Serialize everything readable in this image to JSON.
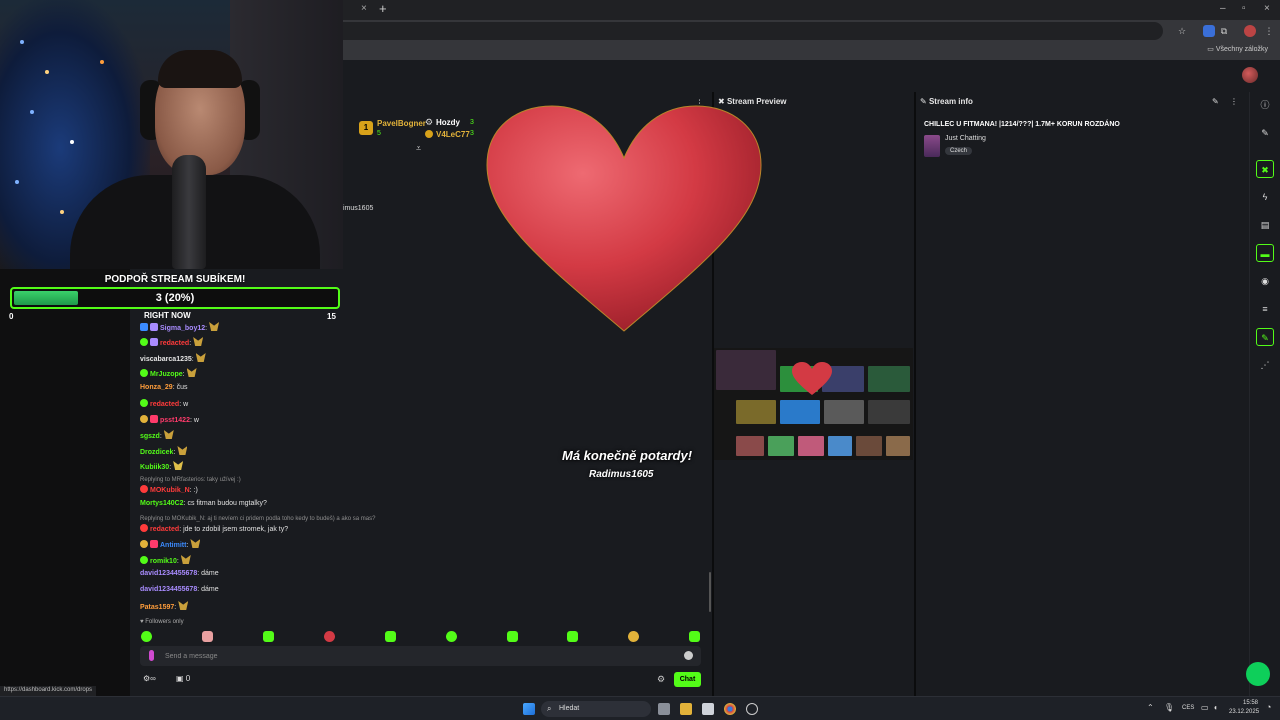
{
  "browser": {
    "tab_close": "×",
    "new_tab": "+",
    "bookmarks_label": "Všechny záložky",
    "window_controls": [
      "–",
      "▫",
      "×"
    ]
  },
  "goal": {
    "title": "PODPOŘ STREAM SUBÍKEM!",
    "progress_text": "3 (20%)",
    "progress_fraction": 0.2,
    "min": "0",
    "max": "15",
    "right_now": "RIGHT NOW"
  },
  "leaderboard": {
    "first": {
      "rank": "1",
      "name": "PavelBogner",
      "count": "5"
    },
    "title": "Hozdy",
    "entries": [
      {
        "name": "PavelBogner",
        "value": "3"
      },
      {
        "name": "V4LeC77",
        "value": "3"
      }
    ]
  },
  "chat": {
    "partial_user": "imus1605",
    "messages": [
      {
        "user": "Sigma_boy12",
        "color": "#a98cff",
        "text": ""
      },
      {
        "user": "redacted",
        "color": "#ff3b3b",
        "text": ""
      },
      {
        "user": "viscabarca1235",
        "color": "#e6e6e6",
        "text": ""
      },
      {
        "user": "MrJuzope",
        "color": "#53fc18",
        "text": ""
      },
      {
        "user": "Honza_29",
        "color": "#ff9d3b",
        "text": "čus"
      },
      {
        "user": "redacted",
        "color": "#ff3b3b",
        "text": "w"
      },
      {
        "user": "psst1422",
        "color": "#ff3b6b",
        "text": "w"
      },
      {
        "user": "sgszd",
        "color": "#53fc18",
        "text": ""
      },
      {
        "user": "Drozdicek",
        "color": "#53fc18",
        "text": ""
      },
      {
        "user": "Kubiik30",
        "color": "#53fc18",
        "text": ""
      },
      {
        "reply": "Replying to MRfasterios: taky užívej :)"
      },
      {
        "user": "MOKubik_N",
        "color": "#ff3b3b",
        "text": ":)"
      },
      {
        "user": "Mortys140C2",
        "color": "#53fc18",
        "text": "cs fitman budou mgtalky?"
      },
      {
        "reply": "Replying to MOKubik_N: aj ti nevíem ci pridem podla toho kedy to budeš) a ako sa mas?"
      },
      {
        "user": "redacted",
        "color": "#ff3b3b",
        "text": "jde to zdobil jsem stromek, jak ty?"
      },
      {
        "user": "Antimitt",
        "color": "#3b8bff",
        "text": ""
      },
      {
        "user": "romik10",
        "color": "#53fc18",
        "text": ""
      },
      {
        "user": "david1234455678",
        "color": "#a98cff",
        "text": "dáme"
      },
      {
        "user": "david1234455678",
        "color": "#a98cff",
        "text": "dáme"
      },
      {
        "user": "Patas1597",
        "color": "#ff9d3b",
        "text": ""
      }
    ],
    "followers_only": "Followers only",
    "input_placeholder": "Send a message",
    "chat_button": "Chat",
    "stat_infinity": "∞",
    "stat_zero": "0"
  },
  "alert": {
    "title": "Má konečně potardy!",
    "subtitle": "Radimus1605"
  },
  "panels": {
    "preview_title": "Stream Preview",
    "info_title": "Stream info"
  },
  "stream_info": {
    "title": "CHILLEC U FITMANA! |1214/???| 1.7M+ KORUN ROZDÁNO",
    "category": "Just Chatting",
    "language_tag": "Czech"
  },
  "status_url": "https://dashboard.kick.com/drops",
  "taskbar": {
    "search": "Hledat",
    "lang": "CES",
    "time": "15:58",
    "date": "23.12.2025"
  },
  "colors": {
    "accent": "#53fc18",
    "panel_bg": "#191b1f",
    "heart": "#d33a44"
  }
}
